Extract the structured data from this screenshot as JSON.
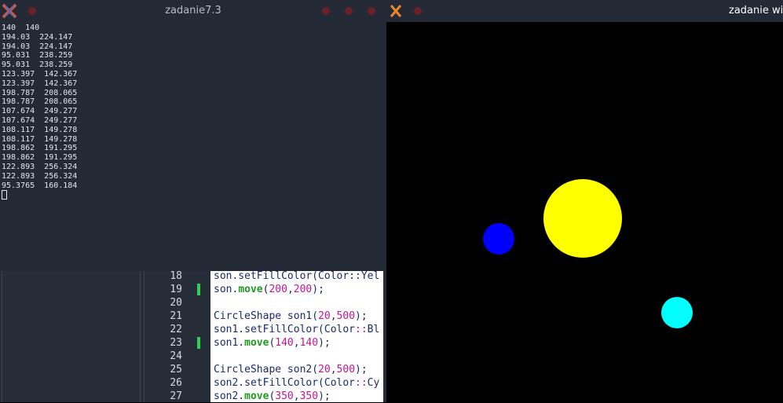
{
  "terminal": {
    "title": "zadanie7.3",
    "lines": [
      "140  140",
      "194.03  224.147",
      "194.03  224.147",
      "95.031  238.259",
      "95.031  238.259",
      "123.397  142.367",
      "123.397  142.367",
      "198.787  208.065",
      "198.787  208.065",
      "107.674  249.277",
      "107.674  249.277",
      "108.117  149.278",
      "108.117  149.278",
      "198.862  191.295",
      "198.862  191.295",
      "122.893  256.324",
      "122.893  256.324",
      "95.3765  160.184"
    ]
  },
  "editor": {
    "lines": [
      {
        "n": "18",
        "tokens": [
          {
            "t": "son.setFillColor(Color::Yel"
          }
        ]
      },
      {
        "n": "19",
        "changed": true,
        "tokens": [
          {
            "t": "son."
          },
          {
            "t": "move",
            "c": "kw"
          },
          {
            "t": "("
          },
          {
            "t": "200",
            "c": "num"
          },
          {
            "t": ","
          },
          {
            "t": "200",
            "c": "num"
          },
          {
            "t": ");"
          }
        ]
      },
      {
        "n": "20",
        "tokens": []
      },
      {
        "n": "21",
        "tokens": [
          {
            "t": "CircleShape son1("
          },
          {
            "t": "20",
            "c": "num"
          },
          {
            "t": ","
          },
          {
            "t": "500",
            "c": "num"
          },
          {
            "t": ");"
          }
        ]
      },
      {
        "n": "22",
        "tokens": [
          {
            "t": "son1.setFillColor(Color"
          },
          {
            "t": "::",
            "c": "num"
          },
          {
            "t": "Bl"
          }
        ]
      },
      {
        "n": "23",
        "changed": true,
        "tokens": [
          {
            "t": "son1."
          },
          {
            "t": "move",
            "c": "kw"
          },
          {
            "t": "("
          },
          {
            "t": "140",
            "c": "num"
          },
          {
            "t": ","
          },
          {
            "t": "140",
            "c": "num"
          },
          {
            "t": ");"
          }
        ]
      },
      {
        "n": "24",
        "tokens": []
      },
      {
        "n": "25",
        "tokens": [
          {
            "t": "CircleShape son2("
          },
          {
            "t": "20",
            "c": "num"
          },
          {
            "t": ","
          },
          {
            "t": "500",
            "c": "num"
          },
          {
            "t": ");"
          }
        ]
      },
      {
        "n": "26",
        "tokens": [
          {
            "t": "son2.setFillColor(Color"
          },
          {
            "t": "::",
            "c": "num"
          },
          {
            "t": "Cy"
          }
        ]
      },
      {
        "n": "27",
        "tokens": [
          {
            "t": "son2."
          },
          {
            "t": "move",
            "c": "kw"
          },
          {
            "t": "("
          },
          {
            "t": "350",
            "c": "num"
          },
          {
            "t": ","
          },
          {
            "t": "350",
            "c": "num"
          },
          {
            "t": ");"
          }
        ]
      }
    ]
  },
  "graphics_window": {
    "title": "zadanie win",
    "shapes": [
      {
        "name": "sun-circle",
        "color": "#ffff00"
      },
      {
        "name": "blue-circle",
        "color": "#0000ff"
      },
      {
        "name": "cyan-circle",
        "color": "#00ffff"
      }
    ]
  },
  "colors": {
    "terminal_bg": "#232a35",
    "close_dot": "#6b1f27",
    "changed_marker": "#2ed14d"
  }
}
